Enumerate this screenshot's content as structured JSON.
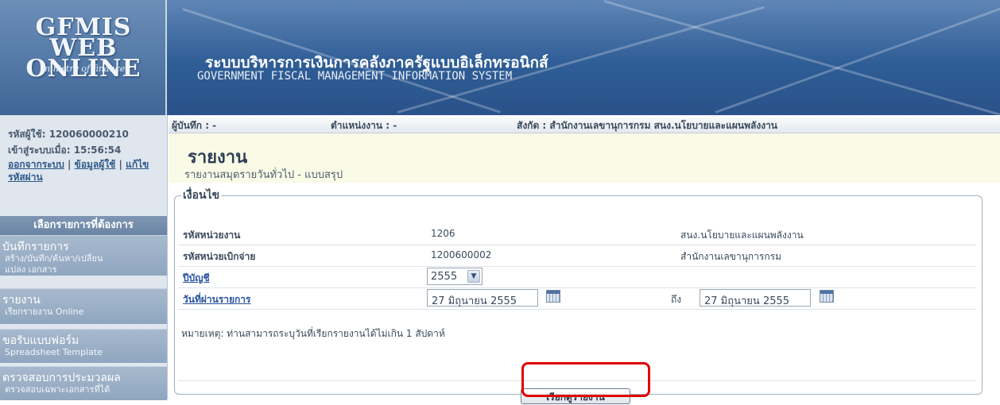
{
  "header": {
    "logo_main": "GFMIS\nWEB ONLINE",
    "logo_sub": "ministry of finance",
    "title_th": "ระบบบริหารการเงินการคลังภาครัฐแบบอิเล็กทรอนิกส์",
    "title_en": "GOVERNMENT FISCAL MANAGEMENT INFORMATION SYSTEM"
  },
  "sidebar": {
    "user_id_label": "รหัสผู้ใช้: 120060000210",
    "login_label": "เข้าสู่ระบบเมื่อ: 15:56:54",
    "logout_link": "ออกจากระบบ",
    "profile_link": "ข้อมูลผู้ใช้",
    "change_pw_link": "แก้ไขรหัสผ่าน",
    "sep": "|",
    "menu_header": "เลือกรายการที่ต้องการ",
    "items": [
      {
        "title": "บันทึกรายการ",
        "sub": "สร้าง/บันทึก/ค้นหา/เปลี่ยน\nแปลง เอกสาร"
      },
      {
        "title": "รายงาน",
        "sub": "เรียกรายงาน Online"
      },
      {
        "title": "ขอรับแบบฟอร์ม",
        "sub": "Spreadsheet Template"
      },
      {
        "title": "ตรวจสอบการประมวลผล",
        "sub": "ตรวจสอบเฉพาะเอกสารที่ได้"
      }
    ]
  },
  "infobar": {
    "recorder": "ผู้บันทึก : -",
    "position": "ตำแหน่งงาน : -",
    "affiliation": "สังกัด : สำนักงานเลขานุการกรม สนง.นโยบายและแผนพลังงาน"
  },
  "page": {
    "title": "รายงาน",
    "subtitle": "รายงานสมุดรายวันทั่วไป - แบบสรุป"
  },
  "conditions": {
    "legend": "เงื่อนไข",
    "unit_code_label": "รหัสหน่วยงาน",
    "unit_code_value": "1206",
    "unit_name": "สนง.นโยบายและแผนพลังงาน",
    "disb_code_label": "รหัสหน่วยเบิกจ่าย",
    "disb_code_value": "1200600002",
    "disb_name": "สำนักงานเลขานุการกรม",
    "fiscal_year_label": "ปีบัญชี",
    "fiscal_year_value": "2555",
    "date_label": "วันที่ผ่านรายการ",
    "date_from": "27 มิถุนายน 2555",
    "to_label": "ถึง",
    "date_to": "27 มิถุนายน 2555",
    "note": "หมายเหตุ: ท่านสามารถระบุวันที่เรียกรายงานได้ไม่เกิน 1 สัปดาห์",
    "submit_label": "เรียกดูรายงาน"
  }
}
